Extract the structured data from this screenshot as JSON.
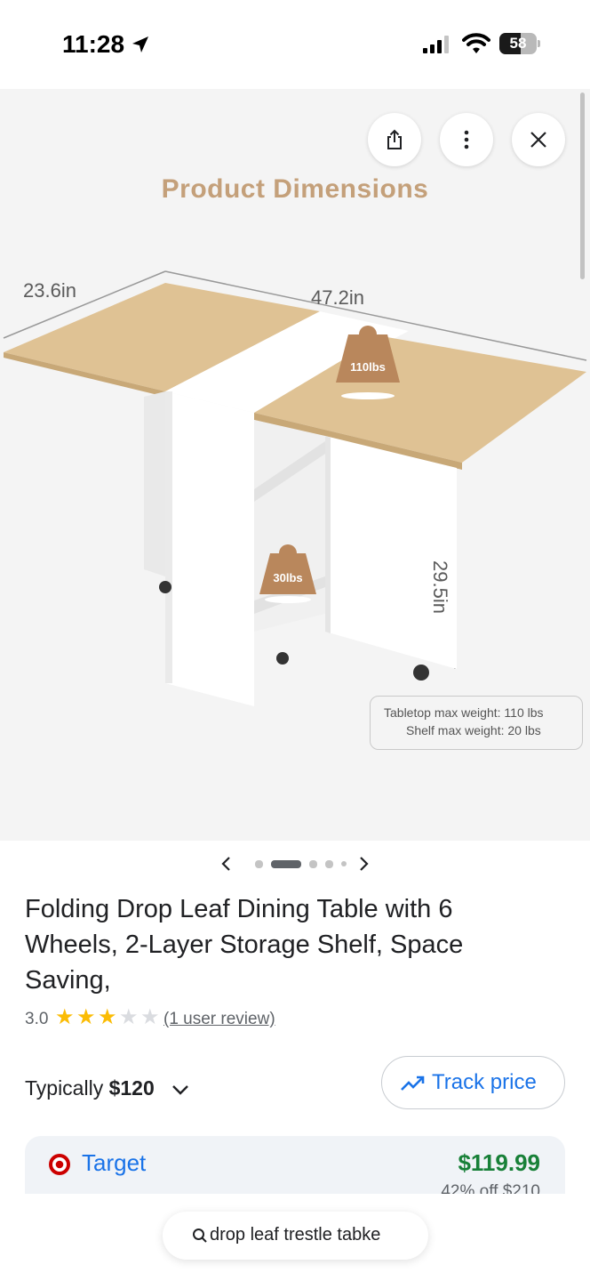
{
  "status_bar": {
    "time": "11:28",
    "battery_level": "58",
    "battery_fraction": 0.58,
    "icons": [
      "location-arrow-icon",
      "cellular-signal-icon",
      "wifi-icon",
      "battery-icon"
    ]
  },
  "image_viewer": {
    "buttons": [
      "share-icon",
      "more-vert-icon",
      "close-icon"
    ],
    "image_text": {
      "title": "Product Dimensions",
      "width_label": "23.6in",
      "length_label": "47.2in",
      "height_label": "29.5in",
      "tabletop_weight": "110lbs",
      "shelf_weight": "30lbs",
      "note_line1": "Tabletop max weight: 110 lbs",
      "note_line2": "Shelf max weight: 20 lbs"
    },
    "carousel": {
      "total": 5,
      "active_index": 1
    }
  },
  "product": {
    "title": "Folding Drop Leaf Dining Table with 6 Wheels, 2-Layer Storage Shelf, Space Saving,",
    "rating": "3.0",
    "rating_stars": 3,
    "rating_max": 5,
    "review_link": "(1 user review)"
  },
  "pricing": {
    "typically_prefix": "Typically",
    "typically_price": "$120",
    "track_price_label": "Track price"
  },
  "seller": {
    "name": "Target",
    "price": "$119.99",
    "discount": "42% off $210",
    "colors": {
      "name": "#1a73e8",
      "price": "#188038",
      "logo": "#cc0000"
    }
  },
  "search": {
    "query": "drop leaf trestle tabke"
  }
}
